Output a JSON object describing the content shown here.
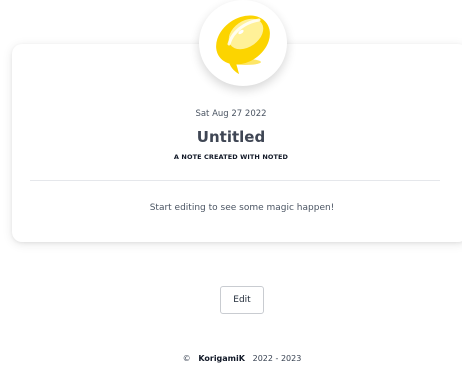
{
  "note": {
    "date": "Sat Aug 27 2022",
    "title": "Untitled",
    "subtitle": "A NOTE CREATED WITH NOTED",
    "body": "Start editing to see some magic happen!"
  },
  "actions": {
    "edit_label": "Edit"
  },
  "footer": {
    "copyright_symbol": "©",
    "brand": "KorigamiK",
    "years": "2022 - 2023"
  },
  "colors": {
    "lemon": "#fcd400",
    "lemon_light": "#fff4a8",
    "card_bg": "#ffffff"
  },
  "icons": {
    "avatar": "lemon-icon"
  }
}
